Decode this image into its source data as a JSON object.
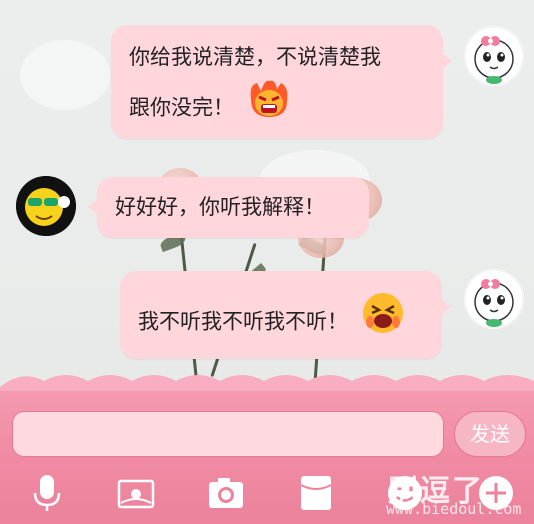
{
  "chat": {
    "messages": [
      {
        "side": "right",
        "lines": [
          "你给我说清楚，不说清楚我",
          "跟你没完！"
        ],
        "emoji": "angry-face-icon"
      },
      {
        "side": "left",
        "lines": [
          "好好好，你听我解释！"
        ]
      },
      {
        "side": "right",
        "lines": [
          "我不听我不听我不听！"
        ],
        "emoji": "crying-yelling-face-icon"
      }
    ]
  },
  "composer": {
    "input_value": "",
    "send_label": "发送",
    "tools": [
      "microphone-icon",
      "image-icon",
      "camera-icon",
      "red-envelope-icon",
      "smiley-icon",
      "plus-icon"
    ]
  },
  "watermark": {
    "text": "别逗了",
    "url": "www.biedoul.com"
  },
  "colors": {
    "bubble": "#ffd6dc",
    "bar": "#f08aa3",
    "accent": "#e47992"
  }
}
